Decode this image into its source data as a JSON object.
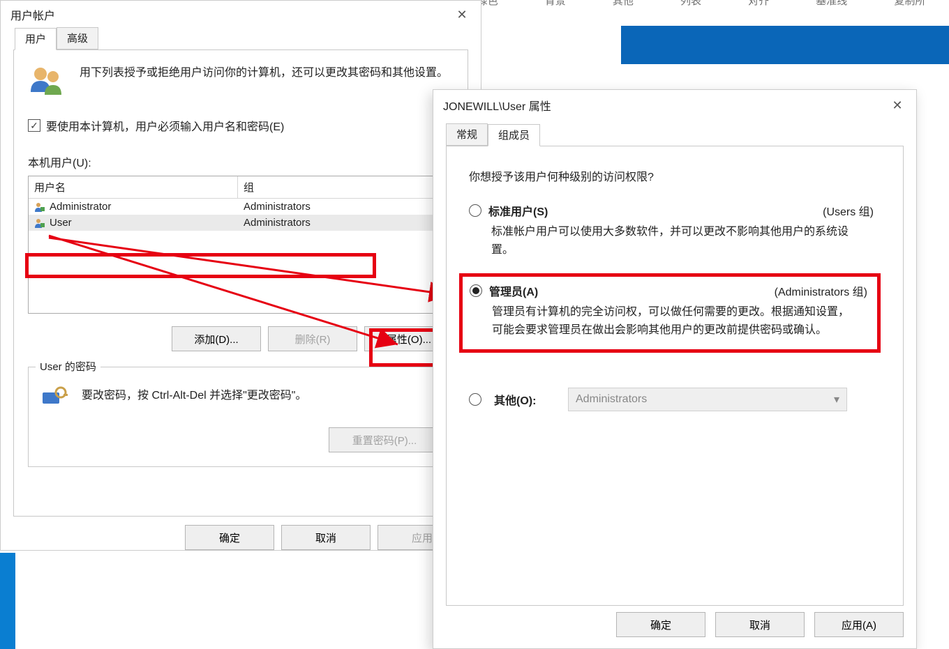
{
  "background": {
    "ribbon_items": [
      "…",
      "绿色",
      "背景",
      "其他",
      "",
      "列表",
      "对齐",
      "基准线",
      "复制所"
    ]
  },
  "ua": {
    "title": "用户帐户",
    "tabs": {
      "users": "用户",
      "advanced": "高级"
    },
    "intro": "用下列表授予或拒绝用户访问你的计算机，还可以更改其密码和其他设置。",
    "checkbox_label": "要使用本计算机，用户必须输入用户名和密码(E)",
    "local_users_label": "本机用户(U):",
    "columns": {
      "user": "用户名",
      "group": "组"
    },
    "rows": [
      {
        "icon": "user-icon",
        "user": "Administrator",
        "group": "Administrators",
        "selected": false
      },
      {
        "icon": "user-icon",
        "user": "User",
        "group": "Administrators",
        "selected": true
      }
    ],
    "buttons": {
      "add": "添加(D)...",
      "delete": "删除(R)",
      "properties": "属性(O)..."
    },
    "password_group": {
      "legend": "User 的密码",
      "hint": "要改密码，按 Ctrl-Alt-Del 并选择\"更改密码\"。",
      "reset": "重置密码(P)..."
    },
    "dlg_buttons": {
      "ok": "确定",
      "cancel": "取消",
      "apply": "应用"
    }
  },
  "pr": {
    "title": "JONEWILL\\User 属性",
    "tabs": {
      "general": "常规",
      "group": "组成员"
    },
    "question": "你想授予该用户何种级别的访问权限?",
    "standard": {
      "label": "标准用户(S)",
      "right": "(Users 组)",
      "desc": "标准帐户用户可以使用大多数软件，并可以更改不影响其他用户的系统设置。"
    },
    "admin": {
      "label": "管理员(A)",
      "right": "(Administrators 组)",
      "desc": "管理员有计算机的完全访问权，可以做任何需要的更改。根据通知设置，可能会要求管理员在做出会影响其他用户的更改前提供密码或确认。"
    },
    "other": {
      "label": "其他(O):",
      "select_value": "Administrators"
    },
    "dlg_buttons": {
      "ok": "确定",
      "cancel": "取消",
      "apply": "应用(A)"
    }
  }
}
